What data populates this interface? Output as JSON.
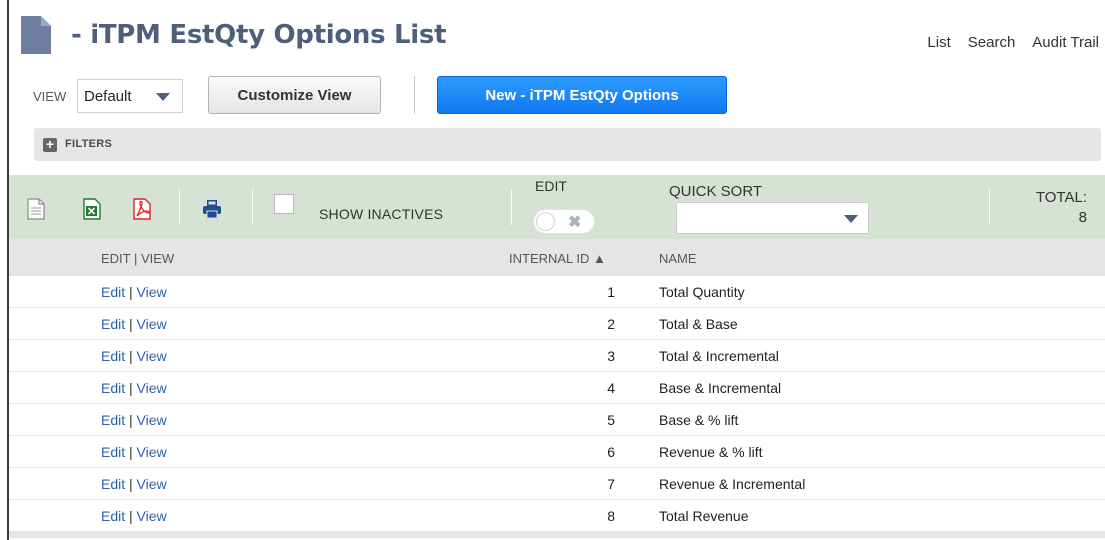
{
  "header": {
    "title": "- iTPM EstQty Options List",
    "links": [
      "List",
      "Search",
      "Audit Trail"
    ]
  },
  "toolbar": {
    "view_label": "VIEW",
    "view_value": "Default",
    "customize_label": "Customize View",
    "new_label": "New - iTPM EstQty Options"
  },
  "filters": {
    "label": "FILTERS"
  },
  "listbar": {
    "show_inactives_label": "SHOW INACTIVES",
    "edit_label": "EDIT",
    "quick_sort_label": "QUICK SORT",
    "total_label": "TOTAL:",
    "total_value": "8",
    "edit_toggle_on": false,
    "show_inactives_checked": false
  },
  "table": {
    "columns": [
      "EDIT | VIEW",
      "INTERNAL ID ▲",
      "NAME"
    ],
    "rows": [
      {
        "edit": "Edit",
        "view": "View",
        "id": "1",
        "name": "Total Quantity"
      },
      {
        "edit": "Edit",
        "view": "View",
        "id": "2",
        "name": "Total & Base"
      },
      {
        "edit": "Edit",
        "view": "View",
        "id": "3",
        "name": "Total & Incremental"
      },
      {
        "edit": "Edit",
        "view": "View",
        "id": "4",
        "name": "Base & Incremental"
      },
      {
        "edit": "Edit",
        "view": "View",
        "id": "5",
        "name": "Base & % lift"
      },
      {
        "edit": "Edit",
        "view": "View",
        "id": "6",
        "name": "Revenue & % lift"
      },
      {
        "edit": "Edit",
        "view": "View",
        "id": "7",
        "name": "Revenue & Incremental"
      },
      {
        "edit": "Edit",
        "view": "View",
        "id": "8",
        "name": "Total Revenue"
      }
    ]
  },
  "colors": {
    "title": "#4d5f79",
    "link": "#2b5fb0",
    "primary_button": "#1078ef",
    "list_bar": "#d5e2d4",
    "excel_icon": "#1e7d32",
    "pdf_icon": "#e02424",
    "print_icon": "#1f4f8f"
  },
  "icons": [
    "document-icon",
    "csv-export-icon",
    "excel-export-icon",
    "pdf-export-icon",
    "print-icon",
    "filters-expand-icon"
  ]
}
